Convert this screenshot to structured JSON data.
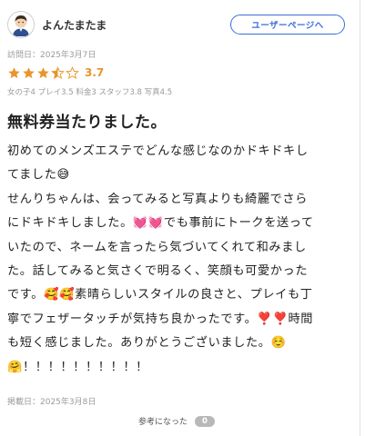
{
  "review": {
    "username": "よんたまたま",
    "user_page_label": "ユーザーページへ",
    "visit_date": "訪問日：2025年3月7日",
    "rating": {
      "value": "3.7",
      "stars_filled": 3.5,
      "stars_total": 5,
      "star_color": "#e8952a"
    },
    "sub_scores": "女の子4 プレイ3.5 料金3 スタッフ3.8 写真4.5",
    "title": "無料券当たりました。",
    "body_lines": [
      "初めてのメンズエステでどんな感じなのかドキドキし",
      "てました😅",
      "せんりちゃんは、会ってみると写真よりも綺麗でさら",
      "にドキドキしました。💓💓でも事前にトークを送って",
      "いたので、ネームを言ったら気づいてくれて和みまし",
      "た。話してみると気さくで明るく、笑顔も可愛かった",
      "です。🥰🥰素晴らしいスタイルの良さと、プレイも丁",
      "寧でフェザータッチが気持ち良かったです。❣️❣️時間",
      "も短く感じました。ありがとうございました。☺️",
      "🤗！！！！！！！！！！"
    ],
    "post_date": "掲載日：2025年3月8日",
    "helpful_label": "参考になった",
    "helpful_count": "0"
  },
  "colors": {
    "accent_blue": "#3a6fd8",
    "star_orange": "#e8952a",
    "muted_text": "#9a9a9a"
  },
  "icons": {
    "avatar": "user-avatar-icon",
    "star": "star-icon"
  }
}
